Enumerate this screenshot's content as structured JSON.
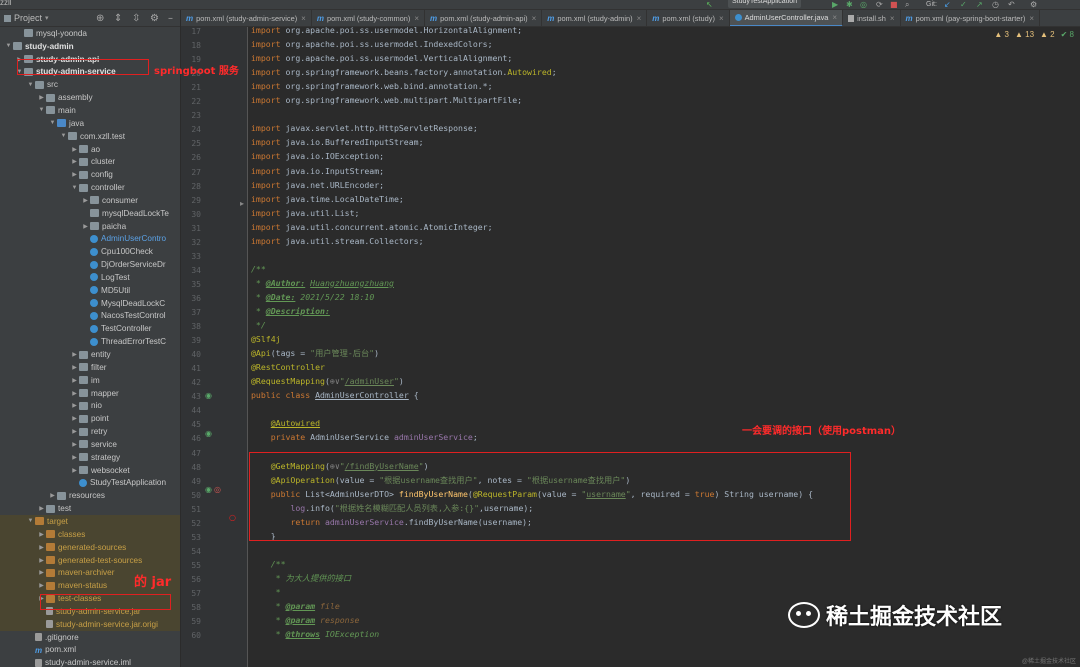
{
  "window": {
    "project_label": "zzll",
    "run_config": "StudyTestApplication",
    "git_label": "Git:"
  },
  "project_panel": {
    "title": "Project",
    "tree": [
      {
        "label": "mysql-yoonda",
        "indent": 1,
        "arrow": "",
        "icon": "folder",
        "cls": ""
      },
      {
        "label": "study-admin",
        "indent": 0,
        "arrow": "▼",
        "icon": "folder",
        "cls": "c-bold"
      },
      {
        "label": "study-admin-api",
        "indent": 1,
        "arrow": "▶",
        "icon": "folder",
        "cls": "c-bold"
      },
      {
        "label": "study-admin-service",
        "indent": 1,
        "arrow": "▼",
        "icon": "folder",
        "cls": "c-bold"
      },
      {
        "label": "src",
        "indent": 2,
        "arrow": "▼",
        "icon": "folder",
        "cls": ""
      },
      {
        "label": "assembly",
        "indent": 3,
        "arrow": "▶",
        "icon": "folder",
        "cls": ""
      },
      {
        "label": "main",
        "indent": 3,
        "arrow": "▼",
        "icon": "folder",
        "cls": ""
      },
      {
        "label": "java",
        "indent": 4,
        "arrow": "▼",
        "icon": "src",
        "cls": ""
      },
      {
        "label": "com.xzll.test",
        "indent": 5,
        "arrow": "▼",
        "icon": "folder",
        "cls": ""
      },
      {
        "label": "ao",
        "indent": 6,
        "arrow": "▶",
        "icon": "folder",
        "cls": ""
      },
      {
        "label": "cluster",
        "indent": 6,
        "arrow": "▶",
        "icon": "folder",
        "cls": ""
      },
      {
        "label": "config",
        "indent": 6,
        "arrow": "▶",
        "icon": "folder",
        "cls": ""
      },
      {
        "label": "controller",
        "indent": 6,
        "arrow": "▼",
        "icon": "folder",
        "cls": ""
      },
      {
        "label": "consumer",
        "indent": 7,
        "arrow": "▶",
        "icon": "folder",
        "cls": ""
      },
      {
        "label": "mysqlDeadLockTe",
        "indent": 7,
        "arrow": "",
        "icon": "folder",
        "cls": ""
      },
      {
        "label": "paicha",
        "indent": 7,
        "arrow": "▶",
        "icon": "folder",
        "cls": ""
      },
      {
        "label": "AdminUserContro",
        "indent": 7,
        "arrow": "",
        "icon": "class",
        "cls": "c-blue"
      },
      {
        "label": "Cpu100Check",
        "indent": 7,
        "arrow": "",
        "icon": "class",
        "cls": ""
      },
      {
        "label": "DjOrderServiceDr",
        "indent": 7,
        "arrow": "",
        "icon": "class",
        "cls": ""
      },
      {
        "label": "LogTest",
        "indent": 7,
        "arrow": "",
        "icon": "class",
        "cls": ""
      },
      {
        "label": "MD5Util",
        "indent": 7,
        "arrow": "",
        "icon": "class",
        "cls": ""
      },
      {
        "label": "MysqlDeadLockC",
        "indent": 7,
        "arrow": "",
        "icon": "class",
        "cls": ""
      },
      {
        "label": "NacosTestControl",
        "indent": 7,
        "arrow": "",
        "icon": "class",
        "cls": ""
      },
      {
        "label": "TestController",
        "indent": 7,
        "arrow": "",
        "icon": "class",
        "cls": ""
      },
      {
        "label": "ThreadErrorTestC",
        "indent": 7,
        "arrow": "",
        "icon": "class",
        "cls": ""
      },
      {
        "label": "entity",
        "indent": 6,
        "arrow": "▶",
        "icon": "folder",
        "cls": ""
      },
      {
        "label": "filter",
        "indent": 6,
        "arrow": "▶",
        "icon": "folder",
        "cls": ""
      },
      {
        "label": "im",
        "indent": 6,
        "arrow": "▶",
        "icon": "folder",
        "cls": ""
      },
      {
        "label": "mapper",
        "indent": 6,
        "arrow": "▶",
        "icon": "folder",
        "cls": ""
      },
      {
        "label": "nio",
        "indent": 6,
        "arrow": "▶",
        "icon": "folder",
        "cls": ""
      },
      {
        "label": "point",
        "indent": 6,
        "arrow": "▶",
        "icon": "folder",
        "cls": ""
      },
      {
        "label": "retry",
        "indent": 6,
        "arrow": "▶",
        "icon": "folder",
        "cls": ""
      },
      {
        "label": "service",
        "indent": 6,
        "arrow": "▶",
        "icon": "folder",
        "cls": ""
      },
      {
        "label": "strategy",
        "indent": 6,
        "arrow": "▶",
        "icon": "folder",
        "cls": ""
      },
      {
        "label": "websocket",
        "indent": 6,
        "arrow": "▶",
        "icon": "folder",
        "cls": ""
      },
      {
        "label": "StudyTestApplication",
        "indent": 6,
        "arrow": "",
        "icon": "class",
        "cls": ""
      },
      {
        "label": "resources",
        "indent": 4,
        "arrow": "▶",
        "icon": "folder",
        "cls": ""
      },
      {
        "label": "test",
        "indent": 3,
        "arrow": "▶",
        "icon": "folder",
        "cls": ""
      },
      {
        "label": "target",
        "indent": 2,
        "arrow": "▼",
        "icon": "target",
        "cls": "c-orange",
        "tgt": true
      },
      {
        "label": "classes",
        "indent": 3,
        "arrow": "▶",
        "icon": "target",
        "cls": "c-orange",
        "tgt": true
      },
      {
        "label": "generated-sources",
        "indent": 3,
        "arrow": "▶",
        "icon": "target",
        "cls": "c-orange",
        "tgt": true
      },
      {
        "label": "generated-test-sources",
        "indent": 3,
        "arrow": "▶",
        "icon": "target",
        "cls": "c-orange",
        "tgt": true
      },
      {
        "label": "maven-archiver",
        "indent": 3,
        "arrow": "▶",
        "icon": "target",
        "cls": "c-orange",
        "tgt": true
      },
      {
        "label": "maven-status",
        "indent": 3,
        "arrow": "▶",
        "icon": "target",
        "cls": "c-orange",
        "tgt": true
      },
      {
        "label": "test-classes",
        "indent": 3,
        "arrow": "▶",
        "icon": "target",
        "cls": "c-orange",
        "tgt": true
      },
      {
        "label": "study-admin-service.jar",
        "indent": 3,
        "arrow": "",
        "icon": "file",
        "cls": "c-orange",
        "tgt": true
      },
      {
        "label": "study-admin-service.jar.origi",
        "indent": 3,
        "arrow": "",
        "icon": "file",
        "cls": "c-orange",
        "tgt": true
      },
      {
        "label": ".gitignore",
        "indent": 2,
        "arrow": "",
        "icon": "file",
        "cls": ""
      },
      {
        "label": "pom.xml",
        "indent": 2,
        "arrow": "",
        "icon": "m",
        "cls": ""
      },
      {
        "label": "study-admin-service.iml",
        "indent": 2,
        "arrow": "",
        "icon": "file",
        "cls": ""
      }
    ]
  },
  "tabs": [
    {
      "label": "pom.xml (study-admin-service)",
      "kind": "m",
      "active": false
    },
    {
      "label": "pom.xml (study-common)",
      "kind": "m",
      "active": false
    },
    {
      "label": "pom.xml (study-admin-api)",
      "kind": "m",
      "active": false
    },
    {
      "label": "pom.xml (study-admin)",
      "kind": "m",
      "active": false
    },
    {
      "label": "pom.xml (study)",
      "kind": "m",
      "active": false
    },
    {
      "label": "AdminUserController.java",
      "kind": "c",
      "active": true
    },
    {
      "label": "install.sh",
      "kind": "f",
      "active": false
    },
    {
      "label": "pom.xml (pay-spring-boot-starter)",
      "kind": "m",
      "active": false
    }
  ],
  "inspections": {
    "warn1": "▲ 3",
    "warn2": "▲ 13",
    "warn3": "▲ 2",
    "info": "✔ 8"
  },
  "line_numbers": [
    "17",
    "18",
    "19",
    "20",
    "21",
    "22",
    "23",
    "24",
    "25",
    "26",
    "27",
    "28",
    "29",
    "30",
    "31",
    "32",
    "33",
    "34",
    "35",
    "36",
    "37",
    "38",
    "39",
    "40",
    "41",
    "42",
    "43",
    "44",
    "45",
    "46",
    "47",
    "48",
    "49",
    "50",
    "51",
    "52",
    "53",
    "54",
    "55",
    "56",
    "57",
    "58",
    "59",
    "60"
  ],
  "annotations": {
    "boot_service": "springboot 服务",
    "jar_label": "的 jar",
    "api_note": "一会要调的接口（使用postman）"
  },
  "watermark": {
    "text": "稀土掘金技术社区",
    "small": "@稀土掘金技术社区"
  }
}
